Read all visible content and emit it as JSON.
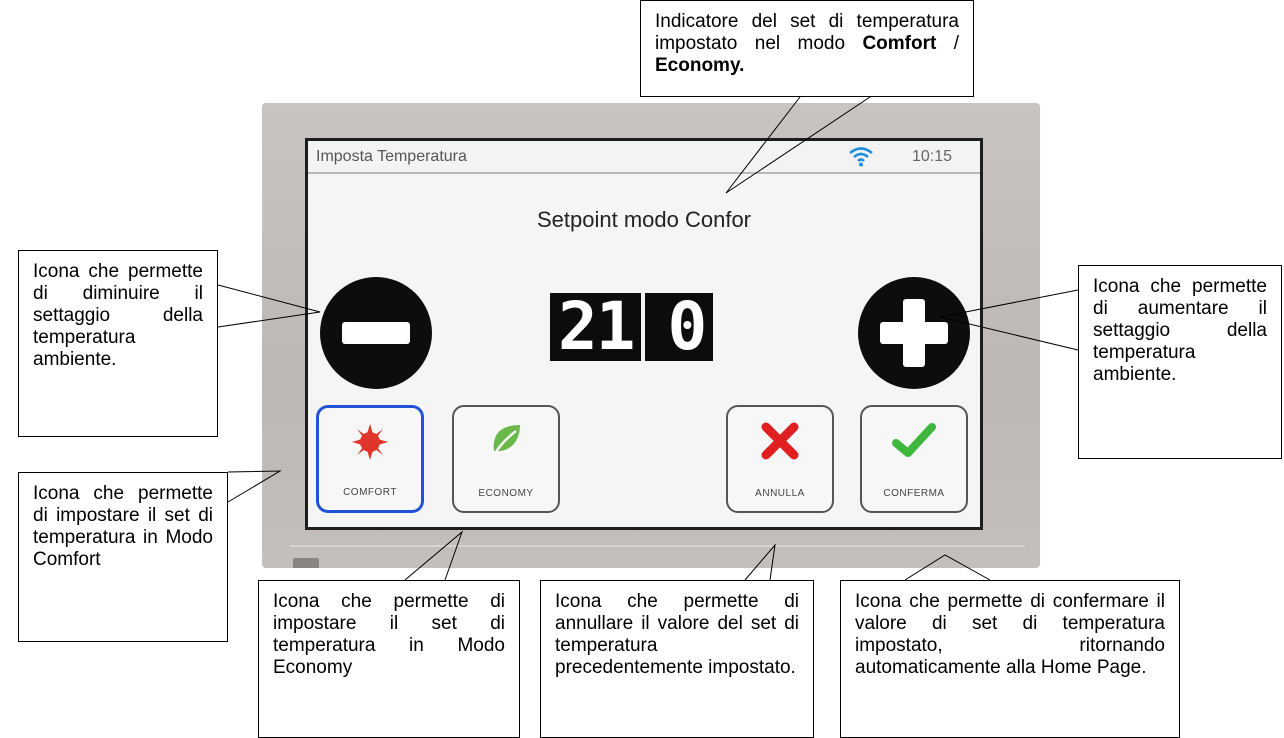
{
  "device": {
    "screen": {
      "status_title": "Imposta Temperatura",
      "clock": "10:15",
      "wifi_icon": "wifi-icon",
      "setpoint_label": "Setpoint modo Confor",
      "value_integer": "21",
      "value_decimal": "0",
      "minus_icon": "minus-icon",
      "plus_icon": "plus-icon",
      "tiles": [
        {
          "label": "COMFORT",
          "icon": "sun-icon",
          "active": true,
          "icon_color": "#e0352a"
        },
        {
          "label": "ECONOMY",
          "icon": "leaf-icon",
          "active": false,
          "icon_color": "#5aa83a"
        },
        {
          "label": "ANNULLA",
          "icon": "close-icon",
          "active": false,
          "icon_color": "#e02020"
        },
        {
          "label": "CONFERMA",
          "icon": "check-icon",
          "active": false,
          "icon_color": "#3db83d"
        }
      ],
      "accent_color": "#2352d6"
    }
  },
  "callouts": {
    "top_indicator": {
      "text_pre": "Indicatore del set di temperatura impostato nel modo ",
      "bold1": "Comfort",
      "sep": " / ",
      "bold2": "Economy."
    },
    "minus": "Icona che permette di diminuire il settaggio della temperatura ambiente.",
    "plus": "Icona che permette di aumentare il settaggio della temperatura ambiente.",
    "comfort": "Icona che permette di impostare il set di temperatura in Modo Comfort",
    "economy": "Icona che permette di impostare il set di temperatura in Modo Economy",
    "annulla": "Icona che permette di annullare il valore del set di temperatura precedentemente impostato.",
    "conferma": "Icona che permette di confermare il valore di set di temperatura impostato, ritornando automaticamente alla Home Page."
  }
}
